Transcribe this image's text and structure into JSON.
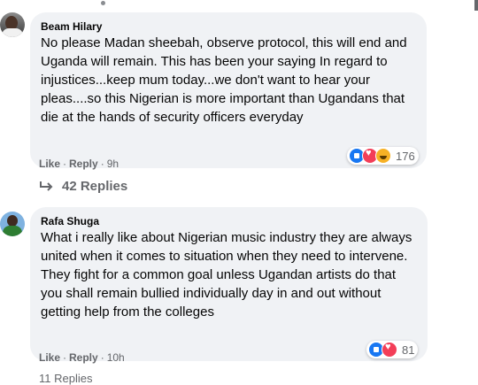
{
  "comments": [
    {
      "author": "Beam Hilary",
      "text": "No please Madan sheebah, observe protocol, this will end and Uganda will remain. This has been your saying In regard to injustices...keep mum today...we don't want to hear your pleas....so this Nigerian is more important than Ugandans that die at the hands of security officers everyday",
      "like_label": "Like",
      "reply_label": "Reply",
      "time": "9h",
      "reaction_count": "176",
      "reaction_icons": [
        "like-icon",
        "love-icon",
        "haha-icon"
      ],
      "replies_label": "42 Replies"
    },
    {
      "author": "Rafa Shuga",
      "text": "What i really like about Nigerian music industry they are always united when it comes to situation when they need to intervene. They fight for a common goal unless Ugandan artists do that you shall remain bullied individually day in and out without getting help from the colleges",
      "like_label": "Like",
      "reply_label": "Reply",
      "time": "10h",
      "reaction_count": "81",
      "reaction_icons": [
        "like-icon",
        "love-icon"
      ],
      "replies_label": "11 Replies"
    }
  ],
  "colors": {
    "bubble": "#f0f2f5",
    "secondary_text": "#65676b",
    "like_blue": "#1877f2",
    "love_red": "#f33e58",
    "haha_yellow": "#f7b125"
  }
}
